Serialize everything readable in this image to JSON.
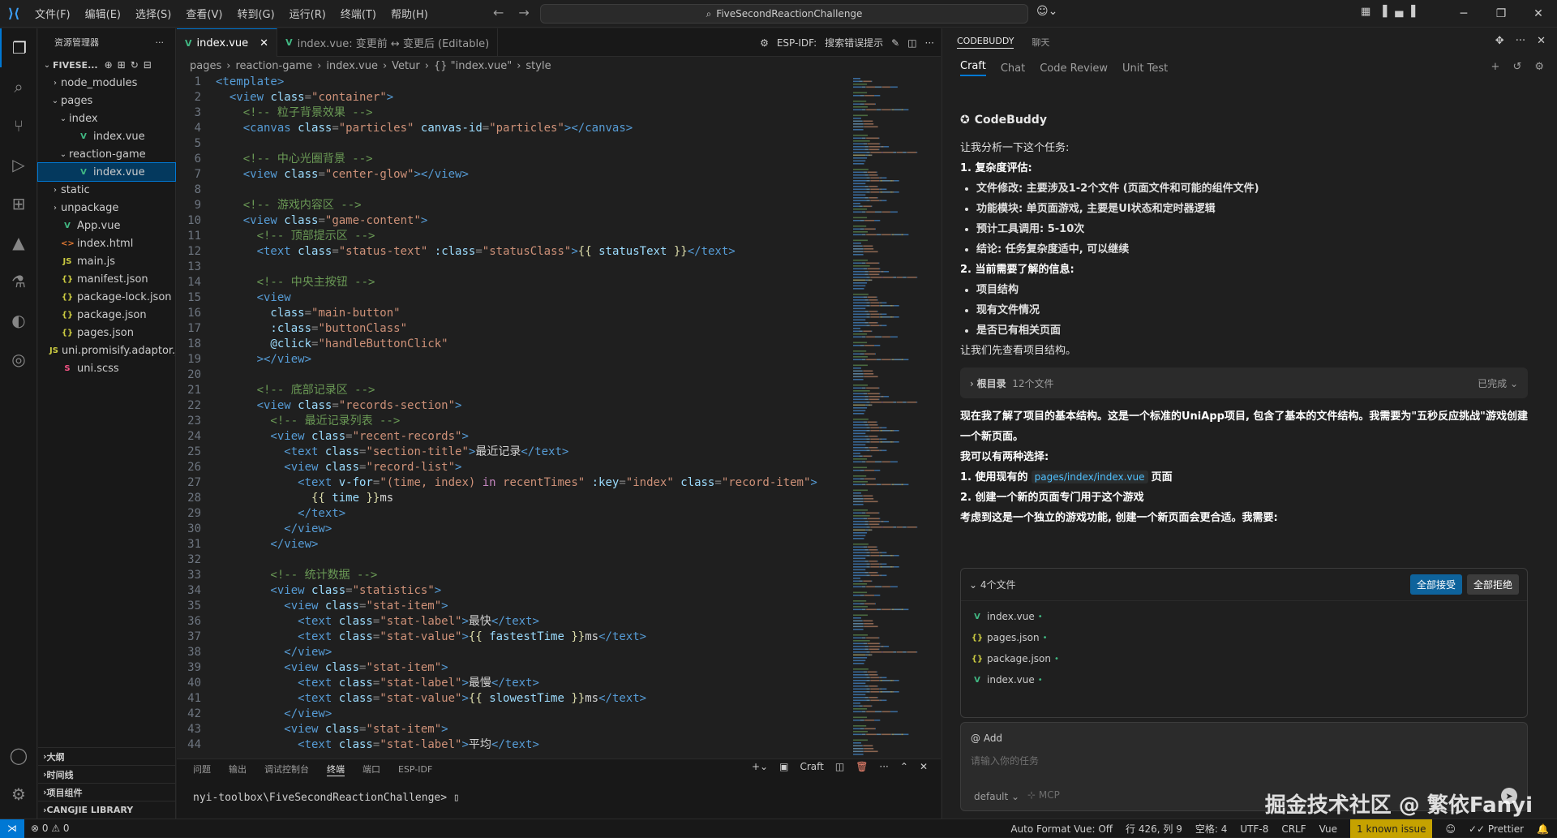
{
  "menus": [
    "文件(F)",
    "编辑(E)",
    "选择(S)",
    "查看(V)",
    "转到(G)",
    "运行(R)",
    "终端(T)",
    "帮助(H)"
  ],
  "search_text": "FiveSecondReactionChallenge",
  "explorer": {
    "title": "资源管理器",
    "root": "FIVESE...",
    "items": [
      {
        "label": "node_modules",
        "indent": 1,
        "tw": "›",
        "type": "folder"
      },
      {
        "label": "pages",
        "indent": 1,
        "tw": "⌄",
        "type": "folder"
      },
      {
        "label": "index",
        "indent": 2,
        "tw": "⌄",
        "type": "folder"
      },
      {
        "label": "index.vue",
        "indent": 3,
        "tw": "",
        "type": "vue"
      },
      {
        "label": "reaction-game",
        "indent": 2,
        "tw": "⌄",
        "type": "folder"
      },
      {
        "label": "index.vue",
        "indent": 3,
        "tw": "",
        "type": "vue",
        "sel": true
      },
      {
        "label": "static",
        "indent": 1,
        "tw": "›",
        "type": "folder"
      },
      {
        "label": "unpackage",
        "indent": 1,
        "tw": "›",
        "type": "folder"
      },
      {
        "label": "App.vue",
        "indent": 1,
        "tw": "",
        "type": "vue"
      },
      {
        "label": "index.html",
        "indent": 1,
        "tw": "",
        "type": "html"
      },
      {
        "label": "main.js",
        "indent": 1,
        "tw": "",
        "type": "js"
      },
      {
        "label": "manifest.json",
        "indent": 1,
        "tw": "",
        "type": "json"
      },
      {
        "label": "package-lock.json",
        "indent": 1,
        "tw": "",
        "type": "json"
      },
      {
        "label": "package.json",
        "indent": 1,
        "tw": "",
        "type": "json"
      },
      {
        "label": "pages.json",
        "indent": 1,
        "tw": "",
        "type": "json"
      },
      {
        "label": "uni.promisify.adaptor.js",
        "indent": 1,
        "tw": "",
        "type": "js"
      },
      {
        "label": "uni.scss",
        "indent": 1,
        "tw": "",
        "type": "scss"
      }
    ],
    "sections": [
      "大纲",
      "时间线",
      "项目组件",
      "CANGJIE LIBRARY"
    ]
  },
  "tabs": [
    {
      "label": "index.vue",
      "active": true
    },
    {
      "label": "index.vue: 变更前 ↔ 变更后 (Editable)",
      "active": false
    }
  ],
  "tab_actions": {
    "esp": "ESP-IDF:",
    "hint": "搜索错误提示"
  },
  "breadcrumb": [
    "pages",
    "reaction-game",
    "index.vue",
    "Vetur",
    "{} \"index.vue\"",
    "style"
  ],
  "code_lines": [
    [
      [
        "t-tag",
        "<template>"
      ]
    ],
    [
      [
        "t-tag",
        "  <view "
      ],
      [
        "t-attr",
        "class"
      ],
      [
        "t-pun",
        "="
      ],
      [
        "t-str",
        "\"container\""
      ],
      [
        "t-tag",
        ">"
      ]
    ],
    [
      [
        "t-com",
        "    <!-- 粒子背景效果 -->"
      ]
    ],
    [
      [
        "t-tag",
        "    <canvas "
      ],
      [
        "t-attr",
        "class"
      ],
      [
        "t-pun",
        "="
      ],
      [
        "t-str",
        "\"particles\" "
      ],
      [
        "t-attr",
        "canvas-id"
      ],
      [
        "t-pun",
        "="
      ],
      [
        "t-str",
        "\"particles\""
      ],
      [
        "t-tag",
        "></canvas>"
      ]
    ],
    [
      [
        "txt",
        ""
      ]
    ],
    [
      [
        "t-com",
        "    <!-- 中心光圈背景 -->"
      ]
    ],
    [
      [
        "t-tag",
        "    <view "
      ],
      [
        "t-attr",
        "class"
      ],
      [
        "t-pun",
        "="
      ],
      [
        "t-str",
        "\"center-glow\""
      ],
      [
        "t-tag",
        "></view>"
      ]
    ],
    [
      [
        "txt",
        ""
      ]
    ],
    [
      [
        "t-com",
        "    <!-- 游戏内容区 -->"
      ]
    ],
    [
      [
        "t-tag",
        "    <view "
      ],
      [
        "t-attr",
        "class"
      ],
      [
        "t-pun",
        "="
      ],
      [
        "t-str",
        "\"game-content\""
      ],
      [
        "t-tag",
        ">"
      ]
    ],
    [
      [
        "t-com",
        "      <!-- 顶部提示区 -->"
      ]
    ],
    [
      [
        "t-tag",
        "      <text "
      ],
      [
        "t-attr",
        "class"
      ],
      [
        "t-pun",
        "="
      ],
      [
        "t-str",
        "\"status-text\" "
      ],
      [
        "t-attr",
        ":class"
      ],
      [
        "t-pun",
        "="
      ],
      [
        "t-str",
        "\"statusClass\""
      ],
      [
        "t-tag",
        ">"
      ],
      [
        "t-mus",
        "{{ "
      ],
      [
        "t-attr",
        "statusText"
      ],
      [
        "t-mus",
        " }}"
      ],
      [
        "t-tag",
        "</text>"
      ]
    ],
    [
      [
        "txt",
        ""
      ]
    ],
    [
      [
        "t-com",
        "      <!-- 中央主按钮 -->"
      ]
    ],
    [
      [
        "t-tag",
        "      <view"
      ]
    ],
    [
      [
        "t-attr",
        "        class"
      ],
      [
        "t-pun",
        "="
      ],
      [
        "t-str",
        "\"main-button\""
      ]
    ],
    [
      [
        "t-attr",
        "        :class"
      ],
      [
        "t-pun",
        "="
      ],
      [
        "t-str",
        "\"buttonClass\""
      ]
    ],
    [
      [
        "t-attr",
        "        @click"
      ],
      [
        "t-pun",
        "="
      ],
      [
        "t-str",
        "\"handleButtonClick\""
      ]
    ],
    [
      [
        "t-tag",
        "      ></view>"
      ]
    ],
    [
      [
        "txt",
        ""
      ]
    ],
    [
      [
        "t-com",
        "      <!-- 底部记录区 -->"
      ]
    ],
    [
      [
        "t-tag",
        "      <view "
      ],
      [
        "t-attr",
        "class"
      ],
      [
        "t-pun",
        "="
      ],
      [
        "t-str",
        "\"records-section\""
      ],
      [
        "t-tag",
        ">"
      ]
    ],
    [
      [
        "t-com",
        "        <!-- 最近记录列表 -->"
      ]
    ],
    [
      [
        "t-tag",
        "        <view "
      ],
      [
        "t-attr",
        "class"
      ],
      [
        "t-pun",
        "="
      ],
      [
        "t-str",
        "\"recent-records\""
      ],
      [
        "t-tag",
        ">"
      ]
    ],
    [
      [
        "t-tag",
        "          <text "
      ],
      [
        "t-attr",
        "class"
      ],
      [
        "t-pun",
        "="
      ],
      [
        "t-str",
        "\"section-title\""
      ],
      [
        "t-tag",
        ">"
      ],
      [
        "txt",
        "最近记录"
      ],
      [
        "t-tag",
        "</text>"
      ]
    ],
    [
      [
        "t-tag",
        "          <view "
      ],
      [
        "t-attr",
        "class"
      ],
      [
        "t-pun",
        "="
      ],
      [
        "t-str",
        "\"record-list\""
      ],
      [
        "t-tag",
        ">"
      ]
    ],
    [
      [
        "t-tag",
        "            <text "
      ],
      [
        "t-attr",
        "v-for"
      ],
      [
        "t-pun",
        "="
      ],
      [
        "t-str",
        "\"(time, index) "
      ],
      [
        "t-kw",
        "in"
      ],
      [
        "t-str",
        " recentTimes\" "
      ],
      [
        "t-attr",
        ":key"
      ],
      [
        "t-pun",
        "="
      ],
      [
        "t-str",
        "\"index\" "
      ],
      [
        "t-attr",
        "class"
      ],
      [
        "t-pun",
        "="
      ],
      [
        "t-str",
        "\"record-item\""
      ],
      [
        "t-tag",
        ">"
      ]
    ],
    [
      [
        "t-mus",
        "              {{ "
      ],
      [
        "t-attr",
        "time"
      ],
      [
        "t-mus",
        " }}"
      ],
      [
        "txt",
        "ms"
      ]
    ],
    [
      [
        "t-tag",
        "            </text>"
      ]
    ],
    [
      [
        "t-tag",
        "          </view>"
      ]
    ],
    [
      [
        "t-tag",
        "        </view>"
      ]
    ],
    [
      [
        "txt",
        ""
      ]
    ],
    [
      [
        "t-com",
        "        <!-- 统计数据 -->"
      ]
    ],
    [
      [
        "t-tag",
        "        <view "
      ],
      [
        "t-attr",
        "class"
      ],
      [
        "t-pun",
        "="
      ],
      [
        "t-str",
        "\"statistics\""
      ],
      [
        "t-tag",
        ">"
      ]
    ],
    [
      [
        "t-tag",
        "          <view "
      ],
      [
        "t-attr",
        "class"
      ],
      [
        "t-pun",
        "="
      ],
      [
        "t-str",
        "\"stat-item\""
      ],
      [
        "t-tag",
        ">"
      ]
    ],
    [
      [
        "t-tag",
        "            <text "
      ],
      [
        "t-attr",
        "class"
      ],
      [
        "t-pun",
        "="
      ],
      [
        "t-str",
        "\"stat-label\""
      ],
      [
        "t-tag",
        ">"
      ],
      [
        "txt",
        "最快"
      ],
      [
        "t-tag",
        "</text>"
      ]
    ],
    [
      [
        "t-tag",
        "            <text "
      ],
      [
        "t-attr",
        "class"
      ],
      [
        "t-pun",
        "="
      ],
      [
        "t-str",
        "\"stat-value\""
      ],
      [
        "t-tag",
        ">"
      ],
      [
        "t-mus",
        "{{ "
      ],
      [
        "t-attr",
        "fastestTime"
      ],
      [
        "t-mus",
        " }}"
      ],
      [
        "txt",
        "ms"
      ],
      [
        "t-tag",
        "</text>"
      ]
    ],
    [
      [
        "t-tag",
        "          </view>"
      ]
    ],
    [
      [
        "t-tag",
        "          <view "
      ],
      [
        "t-attr",
        "class"
      ],
      [
        "t-pun",
        "="
      ],
      [
        "t-str",
        "\"stat-item\""
      ],
      [
        "t-tag",
        ">"
      ]
    ],
    [
      [
        "t-tag",
        "            <text "
      ],
      [
        "t-attr",
        "class"
      ],
      [
        "t-pun",
        "="
      ],
      [
        "t-str",
        "\"stat-label\""
      ],
      [
        "t-tag",
        ">"
      ],
      [
        "txt",
        "最慢"
      ],
      [
        "t-tag",
        "</text>"
      ]
    ],
    [
      [
        "t-tag",
        "            <text "
      ],
      [
        "t-attr",
        "class"
      ],
      [
        "t-pun",
        "="
      ],
      [
        "t-str",
        "\"stat-value\""
      ],
      [
        "t-tag",
        ">"
      ],
      [
        "t-mus",
        "{{ "
      ],
      [
        "t-attr",
        "slowestTime"
      ],
      [
        "t-mus",
        " }}"
      ],
      [
        "txt",
        "ms"
      ],
      [
        "t-tag",
        "</text>"
      ]
    ],
    [
      [
        "t-tag",
        "          </view>"
      ]
    ],
    [
      [
        "t-tag",
        "          <view "
      ],
      [
        "t-attr",
        "class"
      ],
      [
        "t-pun",
        "="
      ],
      [
        "t-str",
        "\"stat-item\""
      ],
      [
        "t-tag",
        ">"
      ]
    ],
    [
      [
        "t-tag",
        "            <text "
      ],
      [
        "t-attr",
        "class"
      ],
      [
        "t-pun",
        "="
      ],
      [
        "t-str",
        "\"stat-label\""
      ],
      [
        "t-tag",
        ">"
      ],
      [
        "txt",
        "平均"
      ],
      [
        "t-tag",
        "</text>"
      ]
    ]
  ],
  "panel": {
    "tabs": [
      "问题",
      "输出",
      "调试控制台",
      "终端",
      "端口",
      "ESP-IDF"
    ],
    "active": "终端",
    "craft": "Craft",
    "prompt": "nyi-toolbox\\FiveSecondReactionChallenge> "
  },
  "chat": {
    "top_tabs": [
      "CODEBUDDY",
      "聊天"
    ],
    "modes": [
      "Craft",
      "Chat",
      "Code Review",
      "Unit Test"
    ],
    "assistant": "CodeBuddy",
    "intro": "让我分析一下这个任务:",
    "s1": "1. 复杂度评估:",
    "s1_items": [
      "文件修改: 主要涉及1-2个文件 (页面文件和可能的组件文件)",
      "功能模块: 单页面游戏, 主要是UI状态和定时器逻辑",
      "预计工具调用: 5-10次",
      "结论: 任务复杂度适中, 可以继续"
    ],
    "s2": "2. 当前需要了解的信息:",
    "s2_items": [
      "项目结构",
      "现有文件情况",
      "是否已有相关页面"
    ],
    "look": "让我们先查看项目结构。",
    "card_title": "根目录",
    "card_count": "12个文件",
    "card_status": "已完成",
    "p1": "现在我了解了项目的基本结构。这是一个标准的UniApp项目, 包含了基本的文件结构。我需要为\"五秒反应挑战\"游戏创建一个新页面。",
    "p2": "我可以有两种选择:",
    "o1_pre": "1. 使用现有的",
    "o1_code": "pages/index/index.vue",
    "o1_post": "页面",
    "o2": "2. 创建一个新的页面专门用于这个游戏",
    "p3": "考虑到这是一个独立的游戏功能, 创建一个新页面会更合适。我需要:",
    "files_title": "4个文件",
    "accept_all": "全部接受",
    "reject_all": "全部拒绝",
    "files": [
      {
        "name": "index.vue",
        "type": "vue"
      },
      {
        "name": "pages.json",
        "type": "json"
      },
      {
        "name": "package.json",
        "type": "json"
      },
      {
        "name": "index.vue",
        "type": "vue"
      }
    ],
    "add": "@ Add",
    "placeholder": "请输入你的任务",
    "model": "default",
    "mcp": "MCP"
  },
  "status": {
    "errors": "0",
    "warnings": "0",
    "autoformat": "Auto Format Vue: Off",
    "pos": "行 426, 列 9",
    "spaces": "空格: 4",
    "enc": "UTF-8",
    "eol": "CRLF",
    "lang": "Vue",
    "issue": "1 known issue",
    "prettier": "Prettier"
  },
  "watermark": "掘金技术社区 @ 繁依Fanyi"
}
